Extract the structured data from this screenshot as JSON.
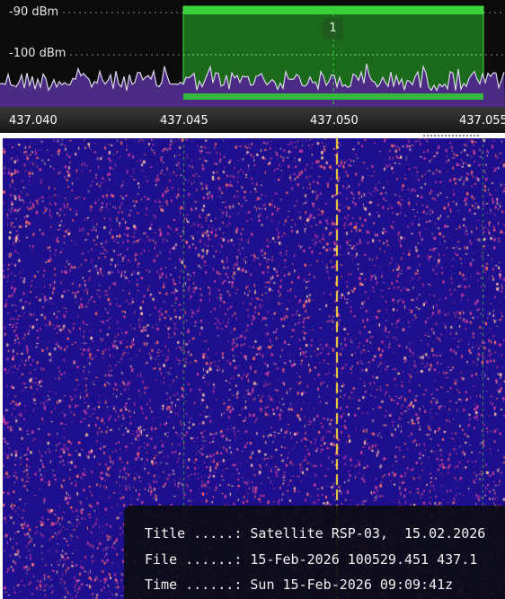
{
  "spectrum": {
    "db_labels": [
      "-90 dBm",
      "-100 dBm"
    ],
    "freq_labels": [
      "437.040",
      "437.045",
      "437.050",
      "437.055"
    ],
    "marker_label": "1",
    "colors": {
      "background": "#0b0b0b",
      "trace": "#d9d6e6",
      "fill": "#4b2b84",
      "selection": "#2f9a2f",
      "selection_border": "#46e046",
      "center_line": "#37c837",
      "grid": "#8a8a8a"
    }
  },
  "waterfall": {
    "colors": {
      "background": "#1d0f8e",
      "speck_hot": "#ff6c6c",
      "speck_warm": "#c93ea1",
      "speck_bright": "#ffc2a8",
      "center_line": "#ffd83a"
    }
  },
  "info_panel": {
    "title_line": "Title .....: Satellite RSP-03,  15.02.2026",
    "file_line": "File ......: 15-Feb-2026 100529.451 437.1",
    "time_line": "Time ......: Sun 15-Feb-2026 09:09:41z"
  }
}
